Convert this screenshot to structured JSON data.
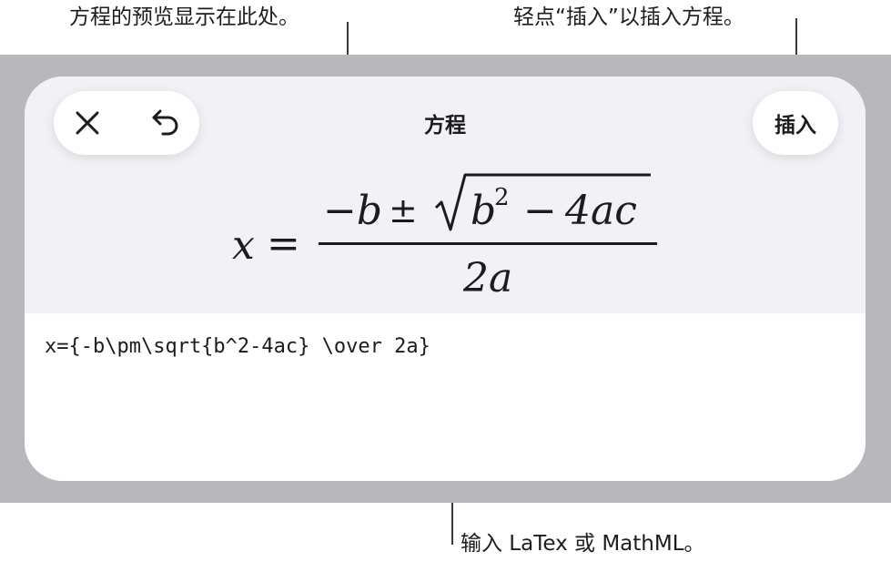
{
  "callouts": {
    "preview": "方程的预览显示在此处。",
    "insert": "轻点“插入”以插入方程。",
    "input": "输入 LaTex 或 MathML。"
  },
  "dialog": {
    "title": "方程",
    "insert_label": "插入",
    "close_icon": "close-icon",
    "undo_icon": "undo-icon"
  },
  "preview": {
    "lhs": "x",
    "equals": "=",
    "numerator": "−b ± √b² − 4ac",
    "minus_b": "−b",
    "pm": "±",
    "b": "b",
    "exponent": "2",
    "minus": "−",
    "four_ac": "4ac",
    "denominator": "2a"
  },
  "editor": {
    "value": "x={-b\\pm\\sqrt{b^2-4ac} \\over 2a}"
  },
  "colors": {
    "backdrop": "#b8b8bc",
    "preview_bg": "#f1f1f6",
    "sheet_bg": "#ffffff",
    "text": "#1c1c1e"
  }
}
